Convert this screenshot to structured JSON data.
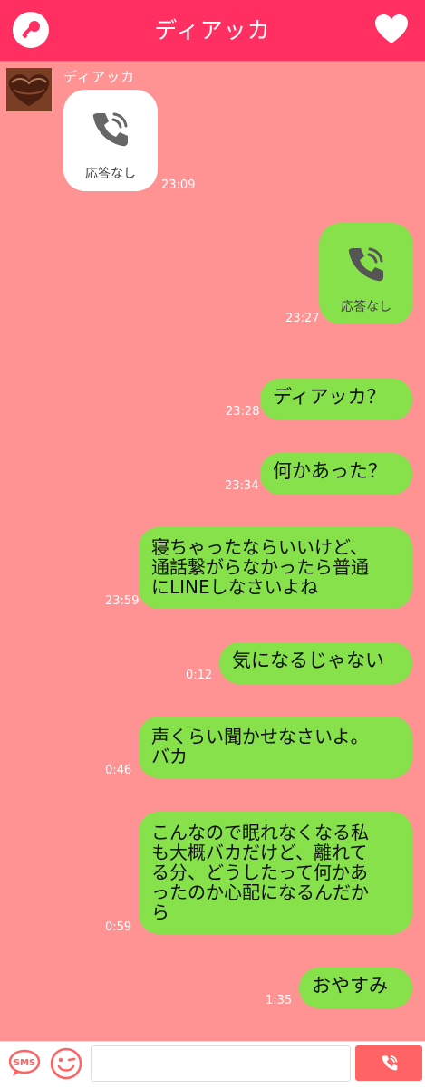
{
  "header": {
    "title": "ディアッカ"
  },
  "contact": {
    "name": "ディアッカ"
  },
  "messages": [
    {
      "call_label": "応答なし",
      "time": "23:09"
    },
    {
      "call_label": "応答なし",
      "time": "23:27"
    },
    {
      "text": "ディアッカ？",
      "time": "23:28"
    },
    {
      "text": "何かあった？",
      "time": "23:34"
    },
    {
      "text": "寝ちゃったならいいけど、\n通話繋がらなかったら普通\nにLINEしなさいよね",
      "time": "23:59"
    },
    {
      "text": "気になるじゃない",
      "time": "0:12"
    },
    {
      "text": "声くらい聞かせなさいよ。\nバカ",
      "time": "0:46"
    },
    {
      "text": "こんなので眠れなくなる私\nも大概バカだけど、離れて\nる分、どうしたって何かあ\nったのか心配になるんだか\nら",
      "time": "0:59"
    },
    {
      "text": "おやすみ",
      "time": "1:35"
    }
  ],
  "footer": {
    "sms_label": "SMS"
  },
  "colors": {
    "header": "#ff2f62",
    "background": "#ff9393",
    "bubble_me": "#86e14a",
    "bubble_them": "#ffffff",
    "call_button": "#ff6363"
  }
}
